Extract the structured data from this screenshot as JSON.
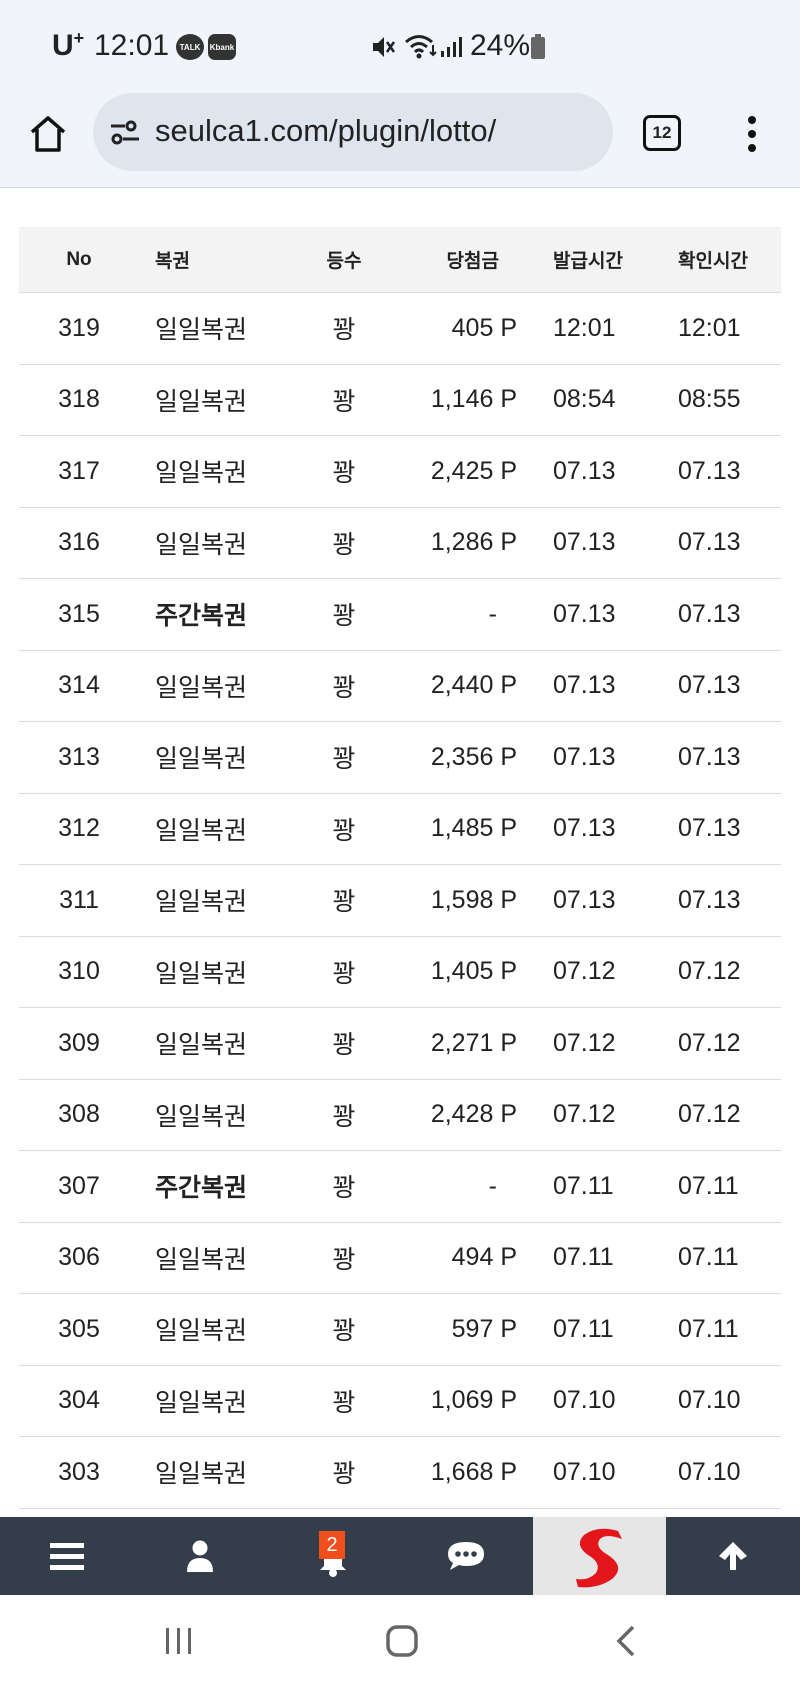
{
  "status": {
    "carrier": "U",
    "carrier_sup": "+",
    "time": "12:01",
    "talk_label": "TALK",
    "kbank_label": "Kbank",
    "battery": "24%"
  },
  "browser": {
    "url": "seulca1.com/plugin/lotto/",
    "tab_count": "12"
  },
  "table": {
    "headers": {
      "no": "No",
      "type": "복권",
      "grade": "등수",
      "prize": "당첨금",
      "issued": "발급시간",
      "checked": "확인시간"
    },
    "rows": [
      {
        "no": "319",
        "type": "일일복권",
        "grade": "꽝",
        "prize": "405 P",
        "issued": "12:01",
        "checked": "12:01",
        "bold": false
      },
      {
        "no": "318",
        "type": "일일복권",
        "grade": "꽝",
        "prize": "1,146 P",
        "issued": "08:54",
        "checked": "08:55",
        "bold": false
      },
      {
        "no": "317",
        "type": "일일복권",
        "grade": "꽝",
        "prize": "2,425 P",
        "issued": "07.13",
        "checked": "07.13",
        "bold": false
      },
      {
        "no": "316",
        "type": "일일복권",
        "grade": "꽝",
        "prize": "1,286 P",
        "issued": "07.13",
        "checked": "07.13",
        "bold": false
      },
      {
        "no": "315",
        "type": "주간복권",
        "grade": "꽝",
        "prize": "-",
        "issued": "07.13",
        "checked": "07.13",
        "bold": true
      },
      {
        "no": "314",
        "type": "일일복권",
        "grade": "꽝",
        "prize": "2,440 P",
        "issued": "07.13",
        "checked": "07.13",
        "bold": false
      },
      {
        "no": "313",
        "type": "일일복권",
        "grade": "꽝",
        "prize": "2,356 P",
        "issued": "07.13",
        "checked": "07.13",
        "bold": false
      },
      {
        "no": "312",
        "type": "일일복권",
        "grade": "꽝",
        "prize": "1,485 P",
        "issued": "07.13",
        "checked": "07.13",
        "bold": false
      },
      {
        "no": "311",
        "type": "일일복권",
        "grade": "꽝",
        "prize": "1,598 P",
        "issued": "07.13",
        "checked": "07.13",
        "bold": false
      },
      {
        "no": "310",
        "type": "일일복권",
        "grade": "꽝",
        "prize": "1,405 P",
        "issued": "07.12",
        "checked": "07.12",
        "bold": false
      },
      {
        "no": "309",
        "type": "일일복권",
        "grade": "꽝",
        "prize": "2,271 P",
        "issued": "07.12",
        "checked": "07.12",
        "bold": false
      },
      {
        "no": "308",
        "type": "일일복권",
        "grade": "꽝",
        "prize": "2,428 P",
        "issued": "07.12",
        "checked": "07.12",
        "bold": false
      },
      {
        "no": "307",
        "type": "주간복권",
        "grade": "꽝",
        "prize": "-",
        "issued": "07.11",
        "checked": "07.11",
        "bold": true
      },
      {
        "no": "306",
        "type": "일일복권",
        "grade": "꽝",
        "prize": "494 P",
        "issued": "07.11",
        "checked": "07.11",
        "bold": false
      },
      {
        "no": "305",
        "type": "일일복권",
        "grade": "꽝",
        "prize": "597 P",
        "issued": "07.11",
        "checked": "07.11",
        "bold": false
      },
      {
        "no": "304",
        "type": "일일복권",
        "grade": "꽝",
        "prize": "1,069 P",
        "issued": "07.10",
        "checked": "07.10",
        "bold": false
      },
      {
        "no": "303",
        "type": "일일복권",
        "grade": "꽝",
        "prize": "1,668 P",
        "issued": "07.10",
        "checked": "07.10",
        "bold": false
      }
    ]
  },
  "bottom_nav": {
    "notification_count": "2",
    "logo_letter": "S"
  },
  "colors": {
    "status_bg": "#f1f5fb",
    "url_bg": "#dfe5ef",
    "nav_bg": "#343e4a",
    "badge": "#f04e1d",
    "logo_red": "#e3161c"
  }
}
